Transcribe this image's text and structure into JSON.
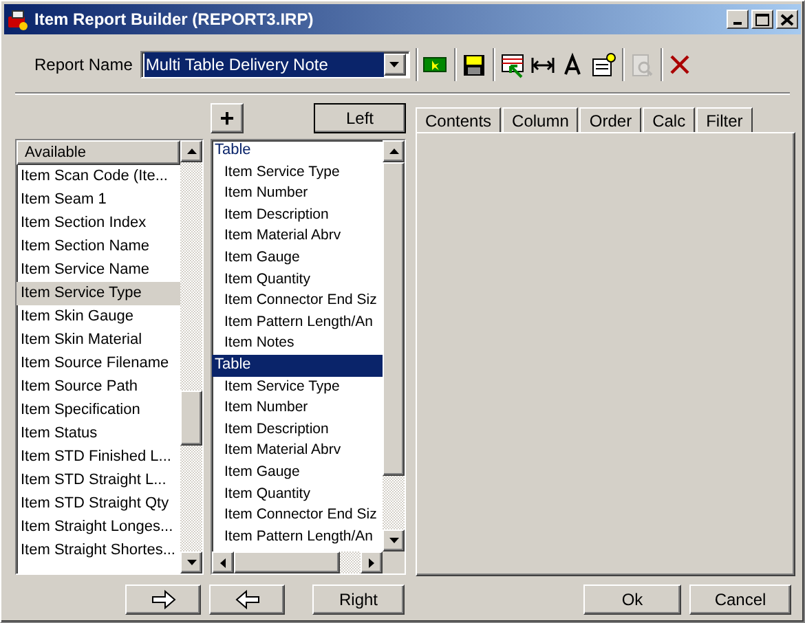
{
  "window": {
    "title": "Item Report Builder (REPORT3.IRP)"
  },
  "report_name": {
    "label": "Report Name",
    "value": "Multi Table Delivery Note",
    "selected": true
  },
  "toolbar": [
    {
      "kind": "new",
      "disabled": false
    },
    {
      "kind": "save",
      "disabled": false
    },
    {
      "kind": "select",
      "disabled": false
    },
    {
      "kind": "width",
      "disabled": false
    },
    {
      "kind": "font",
      "disabled": false
    },
    {
      "kind": "properties",
      "disabled": false
    },
    {
      "kind": "preview",
      "disabled": true
    },
    {
      "kind": "delete",
      "disabled": false
    }
  ],
  "available": {
    "header": "Available",
    "items": [
      {
        "label": "Item Scan Code (Ite...",
        "selected": false
      },
      {
        "label": "Item Seam 1",
        "selected": false
      },
      {
        "label": "Item Section Index",
        "selected": false
      },
      {
        "label": "Item Section Name",
        "selected": false
      },
      {
        "label": "Item Service Name",
        "selected": false
      },
      {
        "label": "Item Service Type",
        "selected": true
      },
      {
        "label": "Item Skin Gauge",
        "selected": false
      },
      {
        "label": "Item Skin Material",
        "selected": false
      },
      {
        "label": "Item Source Filename",
        "selected": false
      },
      {
        "label": "Item Source Path",
        "selected": false
      },
      {
        "label": "Item Specification",
        "selected": false
      },
      {
        "label": "Item Status",
        "selected": false
      },
      {
        "label": "Item STD Finished L...",
        "selected": false
      },
      {
        "label": "Item STD Straight L...",
        "selected": false
      },
      {
        "label": "Item STD Straight Qty",
        "selected": false
      },
      {
        "label": "Item Straight Longes...",
        "selected": false
      },
      {
        "label": "Item Straight Shortes...",
        "selected": false
      }
    ]
  },
  "add_button": {
    "label": "+"
  },
  "left_button": {
    "label": "Left"
  },
  "tables": [
    {
      "label": "Table",
      "selected": false,
      "children": [
        {
          "label": "Item Service Type"
        },
        {
          "label": "Item Number"
        },
        {
          "label": "Item Description"
        },
        {
          "label": "Item Material Abrv"
        },
        {
          "label": "Item Gauge"
        },
        {
          "label": "Item Quantity"
        },
        {
          "label": "Item Connector End Siz"
        },
        {
          "label": "Item Pattern Length/An"
        },
        {
          "label": "Item Notes"
        }
      ]
    },
    {
      "label": "Table",
      "selected": true,
      "children": [
        {
          "label": "Item Service Type"
        },
        {
          "label": "Item Number"
        },
        {
          "label": "Item Description"
        },
        {
          "label": "Item Material Abrv"
        },
        {
          "label": "Item Gauge"
        },
        {
          "label": "Item Quantity"
        },
        {
          "label": "Item Connector End Siz"
        },
        {
          "label": "Item Pattern Length/An"
        }
      ]
    }
  ],
  "tabs": [
    {
      "label": "Contents",
      "selected": false
    },
    {
      "label": "Column",
      "selected": false
    },
    {
      "label": "Order",
      "selected": false
    },
    {
      "label": "Calc",
      "selected": false
    },
    {
      "label": "Filter",
      "selected": false
    }
  ],
  "bottom_buttons": [
    {
      "kind": "move-right"
    },
    {
      "kind": "move-left"
    },
    {
      "kind": "text",
      "label": "Right"
    },
    {
      "kind": "spacer"
    },
    {
      "kind": "text",
      "label": "Ok"
    },
    {
      "kind": "text",
      "label": "Cancel"
    }
  ]
}
